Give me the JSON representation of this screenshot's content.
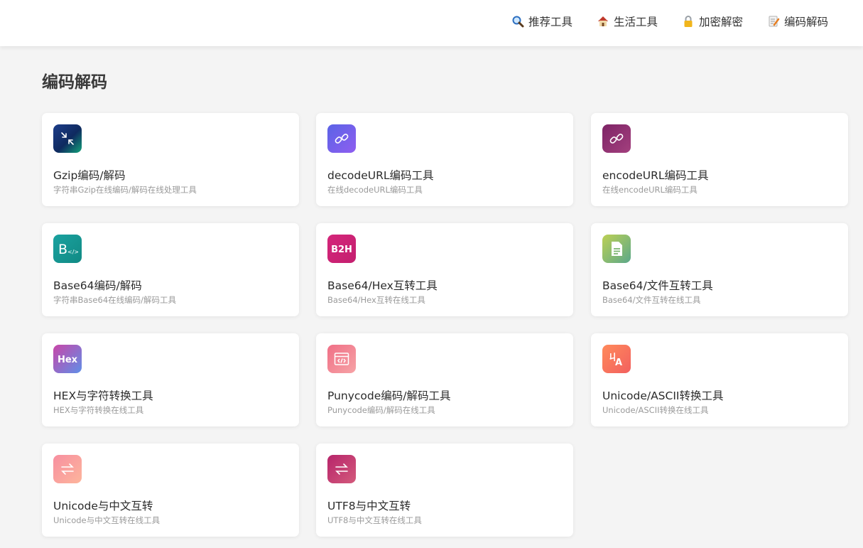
{
  "nav": {
    "items": [
      {
        "label": "推荐工具",
        "icon": "magnifier-icon"
      },
      {
        "label": "生活工具",
        "icon": "house-icon"
      },
      {
        "label": "加密解密",
        "icon": "lock-icon"
      },
      {
        "label": "编码解码",
        "icon": "memo-icon"
      }
    ]
  },
  "section": {
    "title": "编码解码"
  },
  "tools": [
    {
      "title": "Gzip编码/解码",
      "desc": "字符串Gzip在线编码/解码在线处理工具",
      "icon": "compress-arrows-icon",
      "gradient": [
        "#1d3d8a",
        "#12a37a"
      ]
    },
    {
      "title": "decodeURL编码工具",
      "desc": "在线decodeURL编码工具",
      "icon": "link-icon",
      "gradient": [
        "#6a5ae8",
        "#8f5ef0"
      ]
    },
    {
      "title": "encodeURL编码工具",
      "desc": "在线encodeURL编码工具",
      "icon": "link-icon",
      "gradient": [
        "#8e2b6e",
        "#a3407e"
      ]
    },
    {
      "title": "Base64编码/解码",
      "desc": "字符串Base64在线编码/解码工具",
      "icon": "base64-code-icon",
      "gradient": [
        "#1aa2a0",
        "#129089"
      ]
    },
    {
      "title": "Base64/Hex互转工具",
      "desc": "Base64/Hex互转在线工具",
      "icon": "b2h-icon",
      "gradient": [
        "#d4267a",
        "#c41f6f"
      ]
    },
    {
      "title": "Base64/文件互转工具",
      "desc": "Base64/文件互转在线工具",
      "icon": "document-icon",
      "gradient": [
        "#9ccf5a",
        "#5ba88a"
      ]
    },
    {
      "title": "HEX与字符转换工具",
      "desc": "HEX与字符转换在线工具",
      "icon": "hex-icon",
      "gradient": [
        "#c946a8",
        "#5f8fe8"
      ]
    },
    {
      "title": "Punycode编码/解码工具",
      "desc": "Punycode编码/解码在线工具",
      "icon": "code-window-icon",
      "gradient": [
        "#f17a8b",
        "#f6a3a6"
      ]
    },
    {
      "title": "Unicode/ASCII转换工具",
      "desc": "Unicode/ASCII转换在线工具",
      "icon": "translate-icon",
      "gradient": [
        "#ff7e5f",
        "#f25e6a"
      ]
    },
    {
      "title": "Unicode与中文互转",
      "desc": "Unicode与中文互转在线工具",
      "icon": "swap-arrows-icon",
      "gradient": [
        "#f78fa0",
        "#fdb59c"
      ]
    },
    {
      "title": "UTF8与中文互转",
      "desc": "UTF8与中文互转在线工具",
      "icon": "swap-arrows-icon",
      "gradient": [
        "#b7246a",
        "#d35a7c"
      ]
    }
  ]
}
